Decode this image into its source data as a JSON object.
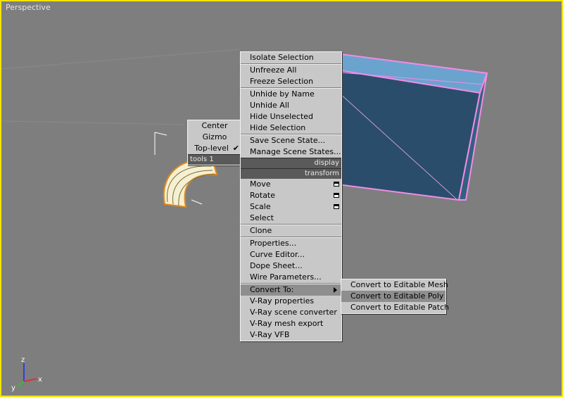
{
  "viewport": {
    "label": "Perspective"
  },
  "quad_left": {
    "items": [
      {
        "label": "Center"
      },
      {
        "label": "Gizmo"
      },
      {
        "label": "Top-level",
        "checked": true
      }
    ],
    "header": "tools 1"
  },
  "quad_main": {
    "display_items": [
      "Isolate Selection",
      "Unfreeze All",
      "Freeze Selection",
      "Unhide by Name",
      "Unhide All",
      "Hide Unselected",
      "Hide Selection",
      "Save Scene State...",
      "Manage Scene States..."
    ],
    "display_header": "display",
    "transform_header": "transform",
    "transform_items": [
      "Move",
      "Rotate",
      "Scale",
      "Select",
      "Clone",
      "Properties...",
      "Curve Editor...",
      "Dope Sheet...",
      "Wire Parameters...",
      "Convert To:",
      "V-Ray properties",
      "V-Ray scene converter",
      "V-Ray mesh export",
      "V-Ray VFB"
    ]
  },
  "convert_submenu": {
    "items": [
      "Convert to Editable Mesh",
      "Convert to Editable Poly",
      "Convert to Editable Patch"
    ],
    "highlighted_index": 1
  },
  "axis_gizmo": {
    "x": "x",
    "y": "y",
    "z": "z"
  },
  "colors": {
    "viewport_border": "#f2e600",
    "box_fill": "#2a4d6b",
    "box_wire": "#f08ce6",
    "torus_wire": "#f5f0c8"
  }
}
